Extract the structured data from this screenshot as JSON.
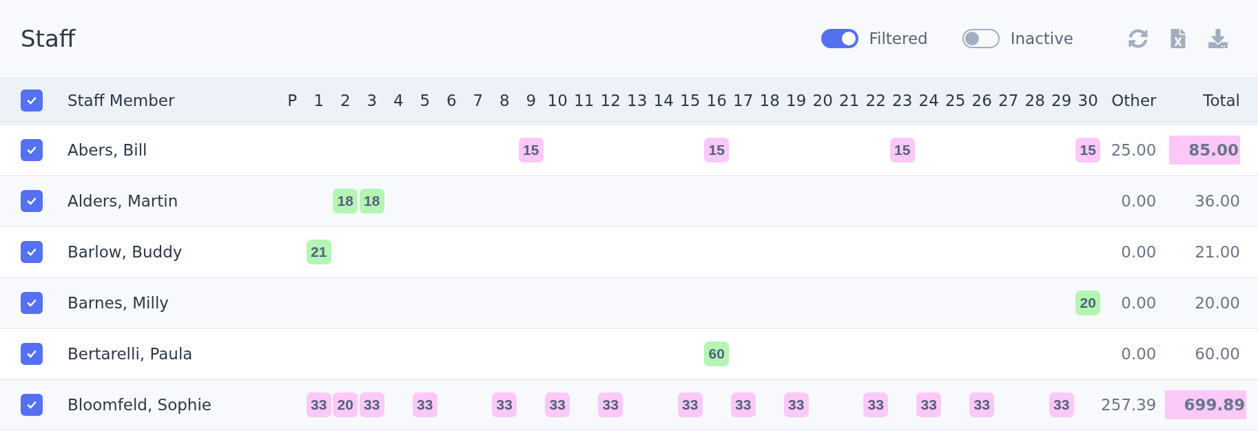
{
  "title": "Staff",
  "toggles": [
    {
      "label": "Filtered",
      "on": true
    },
    {
      "label": "Inactive",
      "on": false
    }
  ],
  "table": {
    "select_all": {
      "checked": true
    },
    "columns": [
      "Staff Member",
      "P",
      "1",
      "2",
      "3",
      "4",
      "5",
      "6",
      "7",
      "8",
      "9",
      "10",
      "11",
      "12",
      "13",
      "14",
      "15",
      "16",
      "17",
      "18",
      "19",
      "20",
      "21",
      "22",
      "23",
      "24",
      "25",
      "26",
      "27",
      "28",
      "29",
      "30",
      "Other",
      "Total"
    ],
    "rows": [
      {
        "checked": true,
        "name": "Abers, Bill",
        "days": [
          {
            "kind": "empty"
          },
          {
            "kind": "empty"
          },
          {
            "kind": "empty"
          },
          {
            "kind": "empty"
          },
          {
            "kind": "empty"
          },
          {
            "kind": "empty"
          },
          {
            "kind": "empty"
          },
          {
            "kind": "empty"
          },
          {
            "kind": "empty"
          },
          {
            "kind": "badge",
            "value": "15",
            "color": "#fbc8f8"
          },
          {
            "kind": "empty"
          },
          {
            "kind": "empty"
          },
          {
            "kind": "empty"
          },
          {
            "kind": "empty"
          },
          {
            "kind": "empty"
          },
          {
            "kind": "empty"
          },
          {
            "kind": "badge",
            "value": "15",
            "color": "#fbc8f8"
          },
          {
            "kind": "empty"
          },
          {
            "kind": "empty"
          },
          {
            "kind": "empty"
          },
          {
            "kind": "empty"
          },
          {
            "kind": "empty"
          },
          {
            "kind": "empty"
          },
          {
            "kind": "badge",
            "value": "15",
            "color": "#fbc8f8"
          },
          {
            "kind": "empty"
          },
          {
            "kind": "empty"
          },
          {
            "kind": "empty"
          },
          {
            "kind": "empty"
          },
          {
            "kind": "empty"
          },
          {
            "kind": "empty"
          },
          {
            "kind": "badge",
            "value": "15",
            "color": "#fbc8f8"
          }
        ],
        "other": "25.00",
        "total": "85.00",
        "total_highlighted": true
      },
      {
        "checked": true,
        "name": "Alders, Martin",
        "days": [
          {
            "kind": "empty"
          },
          {
            "kind": "empty"
          },
          {
            "kind": "badge",
            "value": "18",
            "color": "#b4f5b4"
          },
          {
            "kind": "badge",
            "value": "18",
            "color": "#b4f5b4"
          },
          {
            "kind": "empty"
          },
          {
            "kind": "empty"
          },
          {
            "kind": "empty"
          },
          {
            "kind": "empty"
          },
          {
            "kind": "empty"
          },
          {
            "kind": "empty"
          },
          {
            "kind": "empty"
          },
          {
            "kind": "empty"
          },
          {
            "kind": "empty"
          },
          {
            "kind": "empty"
          },
          {
            "kind": "empty"
          },
          {
            "kind": "empty"
          },
          {
            "kind": "empty"
          },
          {
            "kind": "empty"
          },
          {
            "kind": "empty"
          },
          {
            "kind": "empty"
          },
          {
            "kind": "empty"
          },
          {
            "kind": "empty"
          },
          {
            "kind": "empty"
          },
          {
            "kind": "empty"
          },
          {
            "kind": "empty"
          },
          {
            "kind": "empty"
          },
          {
            "kind": "empty"
          },
          {
            "kind": "empty"
          },
          {
            "kind": "empty"
          },
          {
            "kind": "empty"
          },
          {
            "kind": "empty"
          }
        ],
        "other": "0.00",
        "total": "36.00",
        "total_highlighted": false
      },
      {
        "checked": true,
        "name": "Barlow, Buddy",
        "days": [
          {
            "kind": "empty"
          },
          {
            "kind": "badge",
            "value": "21",
            "color": "#b4f5b4"
          },
          {
            "kind": "empty"
          },
          {
            "kind": "empty"
          },
          {
            "kind": "empty"
          },
          {
            "kind": "empty"
          },
          {
            "kind": "empty"
          },
          {
            "kind": "empty"
          },
          {
            "kind": "empty"
          },
          {
            "kind": "empty"
          },
          {
            "kind": "empty"
          },
          {
            "kind": "empty"
          },
          {
            "kind": "empty"
          },
          {
            "kind": "empty"
          },
          {
            "kind": "empty"
          },
          {
            "kind": "empty"
          },
          {
            "kind": "empty"
          },
          {
            "kind": "empty"
          },
          {
            "kind": "empty"
          },
          {
            "kind": "empty"
          },
          {
            "kind": "empty"
          },
          {
            "kind": "empty"
          },
          {
            "kind": "empty"
          },
          {
            "kind": "empty"
          },
          {
            "kind": "empty"
          },
          {
            "kind": "empty"
          },
          {
            "kind": "empty"
          },
          {
            "kind": "empty"
          },
          {
            "kind": "empty"
          },
          {
            "kind": "empty"
          },
          {
            "kind": "empty"
          }
        ],
        "other": "0.00",
        "total": "21.00",
        "total_highlighted": false
      },
      {
        "checked": true,
        "name": "Barnes, Milly",
        "days": [
          {
            "kind": "empty"
          },
          {
            "kind": "empty"
          },
          {
            "kind": "empty"
          },
          {
            "kind": "empty"
          },
          {
            "kind": "empty"
          },
          {
            "kind": "empty"
          },
          {
            "kind": "empty"
          },
          {
            "kind": "empty"
          },
          {
            "kind": "empty"
          },
          {
            "kind": "empty"
          },
          {
            "kind": "empty"
          },
          {
            "kind": "empty"
          },
          {
            "kind": "empty"
          },
          {
            "kind": "empty"
          },
          {
            "kind": "empty"
          },
          {
            "kind": "empty"
          },
          {
            "kind": "empty"
          },
          {
            "kind": "empty"
          },
          {
            "kind": "empty"
          },
          {
            "kind": "empty"
          },
          {
            "kind": "empty"
          },
          {
            "kind": "empty"
          },
          {
            "kind": "empty"
          },
          {
            "kind": "empty"
          },
          {
            "kind": "empty"
          },
          {
            "kind": "empty"
          },
          {
            "kind": "empty"
          },
          {
            "kind": "empty"
          },
          {
            "kind": "empty"
          },
          {
            "kind": "empty"
          },
          {
            "kind": "badge",
            "value": "20",
            "color": "#b4f5b4"
          }
        ],
        "other": "0.00",
        "total": "20.00",
        "total_highlighted": false
      },
      {
        "checked": true,
        "name": "Bertarelli, Paula",
        "days": [
          {
            "kind": "empty"
          },
          {
            "kind": "empty"
          },
          {
            "kind": "empty"
          },
          {
            "kind": "empty"
          },
          {
            "kind": "empty"
          },
          {
            "kind": "empty"
          },
          {
            "kind": "empty"
          },
          {
            "kind": "empty"
          },
          {
            "kind": "empty"
          },
          {
            "kind": "empty"
          },
          {
            "kind": "empty"
          },
          {
            "kind": "empty"
          },
          {
            "kind": "empty"
          },
          {
            "kind": "empty"
          },
          {
            "kind": "empty"
          },
          {
            "kind": "empty"
          },
          {
            "kind": "badge",
            "value": "60",
            "color": "#b4f5b4"
          },
          {
            "kind": "empty"
          },
          {
            "kind": "empty"
          },
          {
            "kind": "empty"
          },
          {
            "kind": "empty"
          },
          {
            "kind": "empty"
          },
          {
            "kind": "empty"
          },
          {
            "kind": "empty"
          },
          {
            "kind": "empty"
          },
          {
            "kind": "empty"
          },
          {
            "kind": "empty"
          },
          {
            "kind": "empty"
          },
          {
            "kind": "empty"
          },
          {
            "kind": "empty"
          },
          {
            "kind": "empty"
          }
        ],
        "other": "0.00",
        "total": "60.00",
        "total_highlighted": false
      },
      {
        "checked": true,
        "name": "Bloomfeld, Sophie",
        "days": [
          {
            "kind": "empty"
          },
          {
            "kind": "badge",
            "value": "33",
            "color": "#fbc8f8"
          },
          {
            "kind": "badge",
            "value": "20",
            "color": "#fbc8f8"
          },
          {
            "kind": "badge",
            "value": "33",
            "color": "#fbc8f8"
          },
          {
            "kind": "empty"
          },
          {
            "kind": "badge",
            "value": "33",
            "color": "#fbc8f8"
          },
          {
            "kind": "empty"
          },
          {
            "kind": "empty"
          },
          {
            "kind": "badge",
            "value": "33",
            "color": "#fbc8f8"
          },
          {
            "kind": "empty"
          },
          {
            "kind": "badge",
            "value": "33",
            "color": "#fbc8f8"
          },
          {
            "kind": "empty"
          },
          {
            "kind": "badge",
            "value": "33",
            "color": "#fbc8f8"
          },
          {
            "kind": "empty"
          },
          {
            "kind": "empty"
          },
          {
            "kind": "badge",
            "value": "33",
            "color": "#fbc8f8"
          },
          {
            "kind": "empty"
          },
          {
            "kind": "badge",
            "value": "33",
            "color": "#fbc8f8"
          },
          {
            "kind": "empty"
          },
          {
            "kind": "badge",
            "value": "33",
            "color": "#fbc8f8"
          },
          {
            "kind": "empty"
          },
          {
            "kind": "empty"
          },
          {
            "kind": "badge",
            "value": "33",
            "color": "#fbc8f8"
          },
          {
            "kind": "empty"
          },
          {
            "kind": "badge",
            "value": "33",
            "color": "#fbc8f8"
          },
          {
            "kind": "empty"
          },
          {
            "kind": "badge",
            "value": "33",
            "color": "#fbc8f8"
          },
          {
            "kind": "empty"
          },
          {
            "kind": "empty"
          },
          {
            "kind": "badge",
            "value": "33",
            "color": "#fbc8f8"
          },
          {
            "kind": "empty"
          }
        ],
        "other": "257.39",
        "total": "699.89",
        "total_highlighted": true
      }
    ]
  }
}
